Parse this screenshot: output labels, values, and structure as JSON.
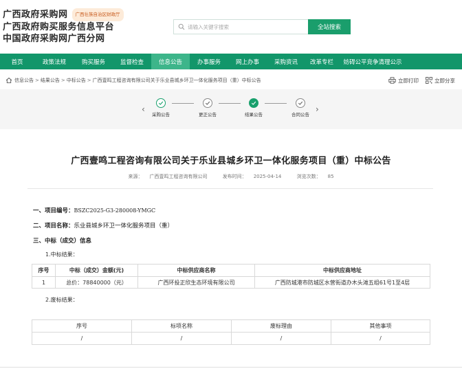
{
  "header": {
    "logo_lines": [
      "广西政府采购网",
      "广西政府购买服务信息平台",
      "中国政府采购网广西分网"
    ],
    "badge": "广西壮族自治区财政厅",
    "search_placeholder": "请输入关键字搜索",
    "search_button": "全站搜索"
  },
  "nav": {
    "items": [
      "首页",
      "政策法规",
      "购买服务",
      "监督检查",
      "信息公告",
      "办事服务",
      "网上办事",
      "采购资讯",
      "改革专栏",
      "妨碍公平竞争清理公示"
    ],
    "active_index": 4
  },
  "breadcrumb": {
    "items": [
      "信息公告",
      "结果公告",
      "中标公告",
      "广西壹鸣工程咨询有限公司关于乐业县城乡环卫一体化服务项目（重）中标公告"
    ],
    "separator": ">"
  },
  "tools": {
    "print": "立即打印",
    "share": "立即分享"
  },
  "steps": {
    "items": [
      {
        "label": "采购公告",
        "state": "done"
      },
      {
        "label": "更正公告",
        "state": "done"
      },
      {
        "label": "结果公告",
        "state": "current"
      },
      {
        "label": "合同公告",
        "state": "pending"
      }
    ]
  },
  "article": {
    "title": "广西壹鸣工程咨询有限公司关于乐业县城乡环卫一体化服务项目（重）中标公告",
    "source_label": "来源：",
    "source": "广西壹鸣工程咨询有限公司",
    "date_label": "发布时间：",
    "date": "2025-04-14",
    "views_label": "浏览次数：",
    "views": "85",
    "section1_label": "一、项目编号：",
    "section1_value": "BSZC2025-G3-280008-YMGC",
    "section2_label": "二、项目名称：",
    "section2_value": "乐业县城乡环卫一体化服务项目（重）",
    "section3_label": "三、中标（成交）信息",
    "sub1": "1.中标结果：",
    "sub2": "2.废标结果：",
    "table1": {
      "headers": [
        "序号",
        "中标（成交）金额(元)",
        "中标供应商名称",
        "中标供应商地址"
      ],
      "rows": [
        [
          "1",
          "总价：78840000（元）",
          "广西环投正欣生态环境有限公司",
          "广西防城港市防城区水营街道办木头滩五组61号1至4层"
        ]
      ]
    },
    "table2": {
      "headers": [
        "序号",
        "标项名称",
        "废标理由",
        "其他事项"
      ],
      "rows": [
        [
          "/",
          "/",
          "/",
          "/"
        ]
      ]
    }
  }
}
